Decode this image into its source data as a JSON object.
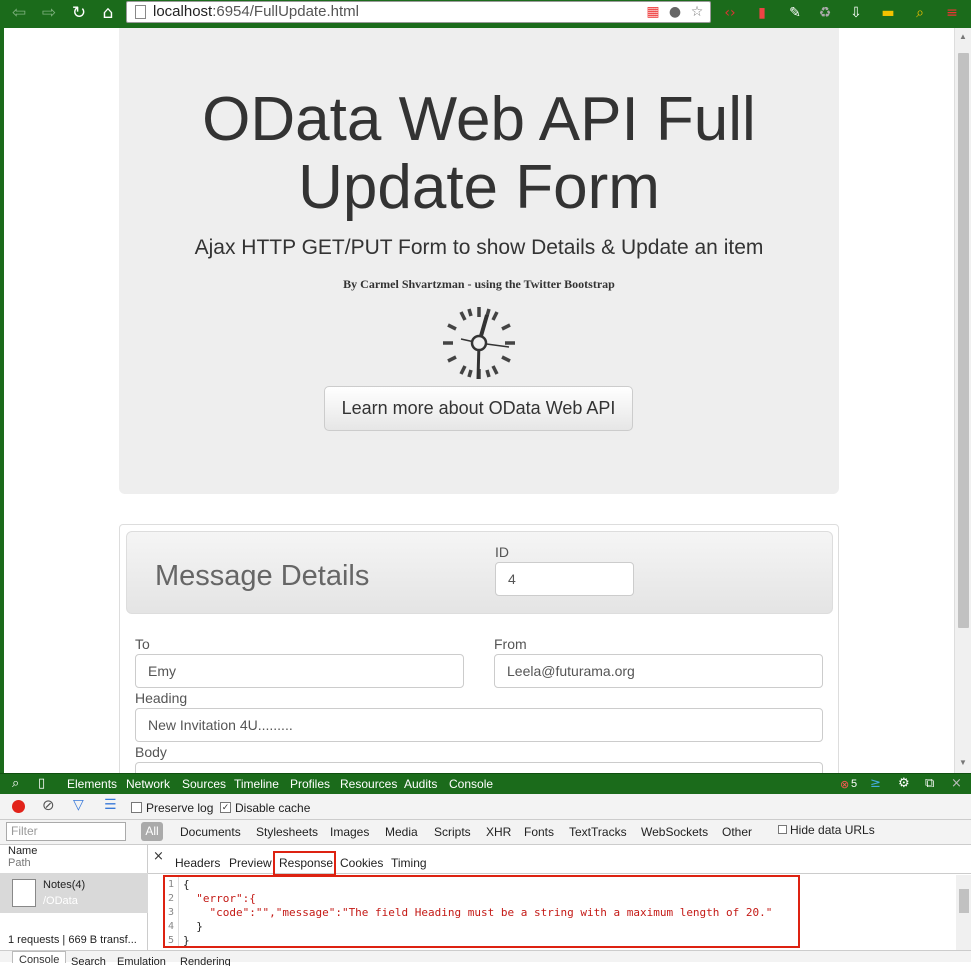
{
  "browser": {
    "url_host": "localhost",
    "url_rest": ":6954/FullUpdate.html"
  },
  "jumbotron": {
    "title_line1": "OData Web API Full",
    "title_line2": "Update Form",
    "subtitle": "Ajax HTTP GET/PUT Form to show Details & Update an item",
    "byline": "By Carmel Shvartzman - using the Twitter Bootstrap",
    "button_label": "Learn more about OData Web API"
  },
  "form": {
    "title": "Message Details",
    "id_label": "ID",
    "id_value": "4",
    "to_label": "To",
    "to_value": "Emy",
    "from_label": "From",
    "from_value": "Leela@futurama.org",
    "heading_label": "Heading",
    "heading_value": "New Invitation 4U.........",
    "body_label": "Body"
  },
  "devtools": {
    "tabs": [
      "Elements",
      "Network",
      "Sources",
      "Timeline",
      "Profiles",
      "Resources",
      "Audits",
      "Console"
    ],
    "error_count": "5",
    "preserve_log": "Preserve log",
    "disable_cache": "Disable cache",
    "filter_placeholder": "Filter",
    "filter_all": "All",
    "filter_types": [
      "Documents",
      "Stylesheets",
      "Images",
      "Media",
      "Scripts",
      "XHR",
      "Fonts",
      "TextTracks",
      "WebSockets",
      "Other"
    ],
    "hide_data_urls": "Hide data URLs",
    "col_name": "Name",
    "col_path": "Path",
    "request_name": "Notes(4)",
    "request_path": "/OData",
    "summary": "1 requests | 669 B transf...",
    "detail_tabs": [
      "Headers",
      "Preview",
      "Response",
      "Cookies",
      "Timing"
    ],
    "response_lines": [
      "{",
      "  \"error\":{",
      "    \"code\":\"\",\"message\":\"The field Heading must be a string with a maximum length of 20.\"",
      "  }",
      "}"
    ],
    "bottom_tabs": [
      "Console",
      "Search",
      "Emulation",
      "Rendering"
    ]
  },
  "colors": {
    "chrome_green": "#1b6b1b",
    "highlight_red": "#dd2211"
  }
}
